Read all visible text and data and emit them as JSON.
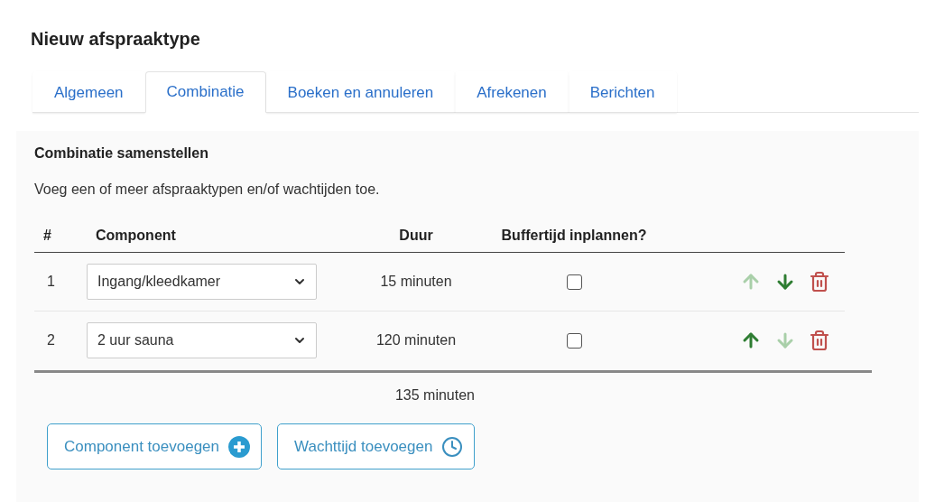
{
  "title": "Nieuw afspraaktype",
  "tabs": [
    {
      "label": "Algemeen",
      "selected": false
    },
    {
      "label": "Combinatie",
      "selected": true
    },
    {
      "label": "Boeken en annuleren",
      "selected": false
    },
    {
      "label": "Afrekenen",
      "selected": false
    },
    {
      "label": "Berichten",
      "selected": false
    }
  ],
  "section": {
    "heading": "Combinatie samenstellen",
    "description": "Voeg een of meer afspraaktypen en/of wachtijden toe."
  },
  "table": {
    "columns": [
      "#",
      "Component",
      "Duur",
      "Buffertijd inplannen?"
    ],
    "rows": [
      {
        "number": "1",
        "component": "Ingang/kleedkamer",
        "duration": "15 minuten",
        "buffer_checked": false,
        "up_disabled": true,
        "down_disabled": false
      },
      {
        "number": "2",
        "component": "2 uur sauna",
        "duration": "120 minuten",
        "buffer_checked": false,
        "up_disabled": false,
        "down_disabled": true
      }
    ],
    "total": "135 minuten"
  },
  "buttons": [
    {
      "label": "Component toevoegen",
      "kind": "add"
    },
    {
      "label": "Wachttijd toevoegen",
      "kind": "wait"
    }
  ]
}
